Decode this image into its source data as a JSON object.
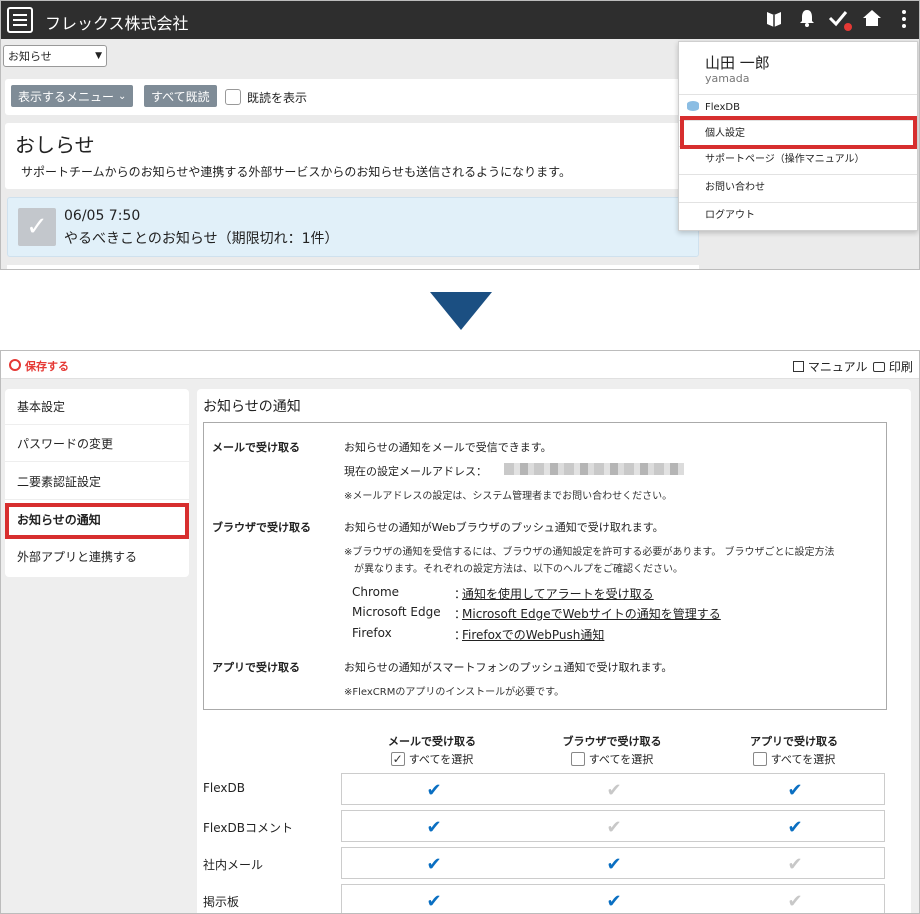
{
  "top": {
    "company_name": "フレックス株式会社",
    "icons": [
      "hamburger-icon",
      "bookmark-icon",
      "bell-icon",
      "check-icon",
      "home-icon",
      "kebab-icon"
    ],
    "notice_select": {
      "value": "お知らせ"
    },
    "toolbar": {
      "display_menu_label": "表示するメニュー",
      "mark_all_read_label": "すべて既読",
      "show_read_label": "既読を表示"
    },
    "notice": {
      "title": "おしらせ",
      "description": "サポートチームからのお知らせや連携する外部サービスからのお知らせも送信されるようになります。"
    },
    "todo": {
      "date": "06/05 7:50",
      "title": "やるべきことのお知らせ（期限切れ：1件）"
    },
    "user_menu": {
      "name": "山田 一郎",
      "user_id": "yamada",
      "items": [
        "FlexDB",
        "個人設定",
        "サポートページ（操作マニュアル）",
        "お問い合わせ",
        "ログアウト"
      ]
    }
  },
  "bottom": {
    "save_label": "保存する",
    "manual_label": "マニュアル",
    "print_label": "印刷",
    "nav": [
      "基本設定",
      "パスワードの変更",
      "二要素認証設定",
      "お知らせの通知",
      "外部アプリと連携する"
    ],
    "active_nav": "お知らせの通知",
    "panel_title": "お知らせの通知",
    "sections": {
      "mail": {
        "label": "メールで受け取る",
        "text": "お知らせの通知をメールで受信できます。",
        "address_label": "現在の設定メールアドレス：",
        "note": "※メールアドレスの設定は、システム管理者までお問い合わせください。"
      },
      "browser": {
        "label": "ブラウザで受け取る",
        "text": "お知らせの通知がWebブラウザのプッシュ通知で受け取れます。",
        "note1": "※ブラウザの通知を受信するには、ブラウザの通知設定を許可する必要があります。 ブラウザごとに設定方法",
        "note2": "が異なります。それぞれの設定方法は、以下のヘルプをご確認ください。",
        "links": [
          {
            "name": "Chrome",
            "link": "通知を使用してアラートを受け取る"
          },
          {
            "name": "Microsoft Edge",
            "link": "Microsoft EdgeでWebサイトの通知を管理する"
          },
          {
            "name": "Firefox",
            "link": "FirefoxでのWebPush通知"
          }
        ]
      },
      "app": {
        "label": "アプリで受け取る",
        "text": "お知らせの通知がスマートフォンのプッシュ通知で受け取れます。",
        "note": "※FlexCRMのアプリのインストールが必要です。"
      }
    },
    "colon": "：",
    "columns": [
      "メールで受け取る",
      "ブラウザで受け取る",
      "アプリで受け取る"
    ],
    "select_all_label": "すべてを選択",
    "select_all_state": [
      true,
      false,
      false
    ],
    "rows": [
      {
        "label": "FlexDB",
        "values": [
          true,
          false,
          true
        ]
      },
      {
        "label": "FlexDBコメント",
        "values": [
          true,
          false,
          true
        ]
      },
      {
        "label": "社内メール",
        "values": [
          true,
          true,
          false
        ]
      },
      {
        "label": "掲示板",
        "values": [
          true,
          true,
          false
        ]
      }
    ],
    "colors": {
      "check_on": "#0a6fc2",
      "check_off": "#c8c8c8",
      "highlight": "#d72e2e"
    }
  }
}
